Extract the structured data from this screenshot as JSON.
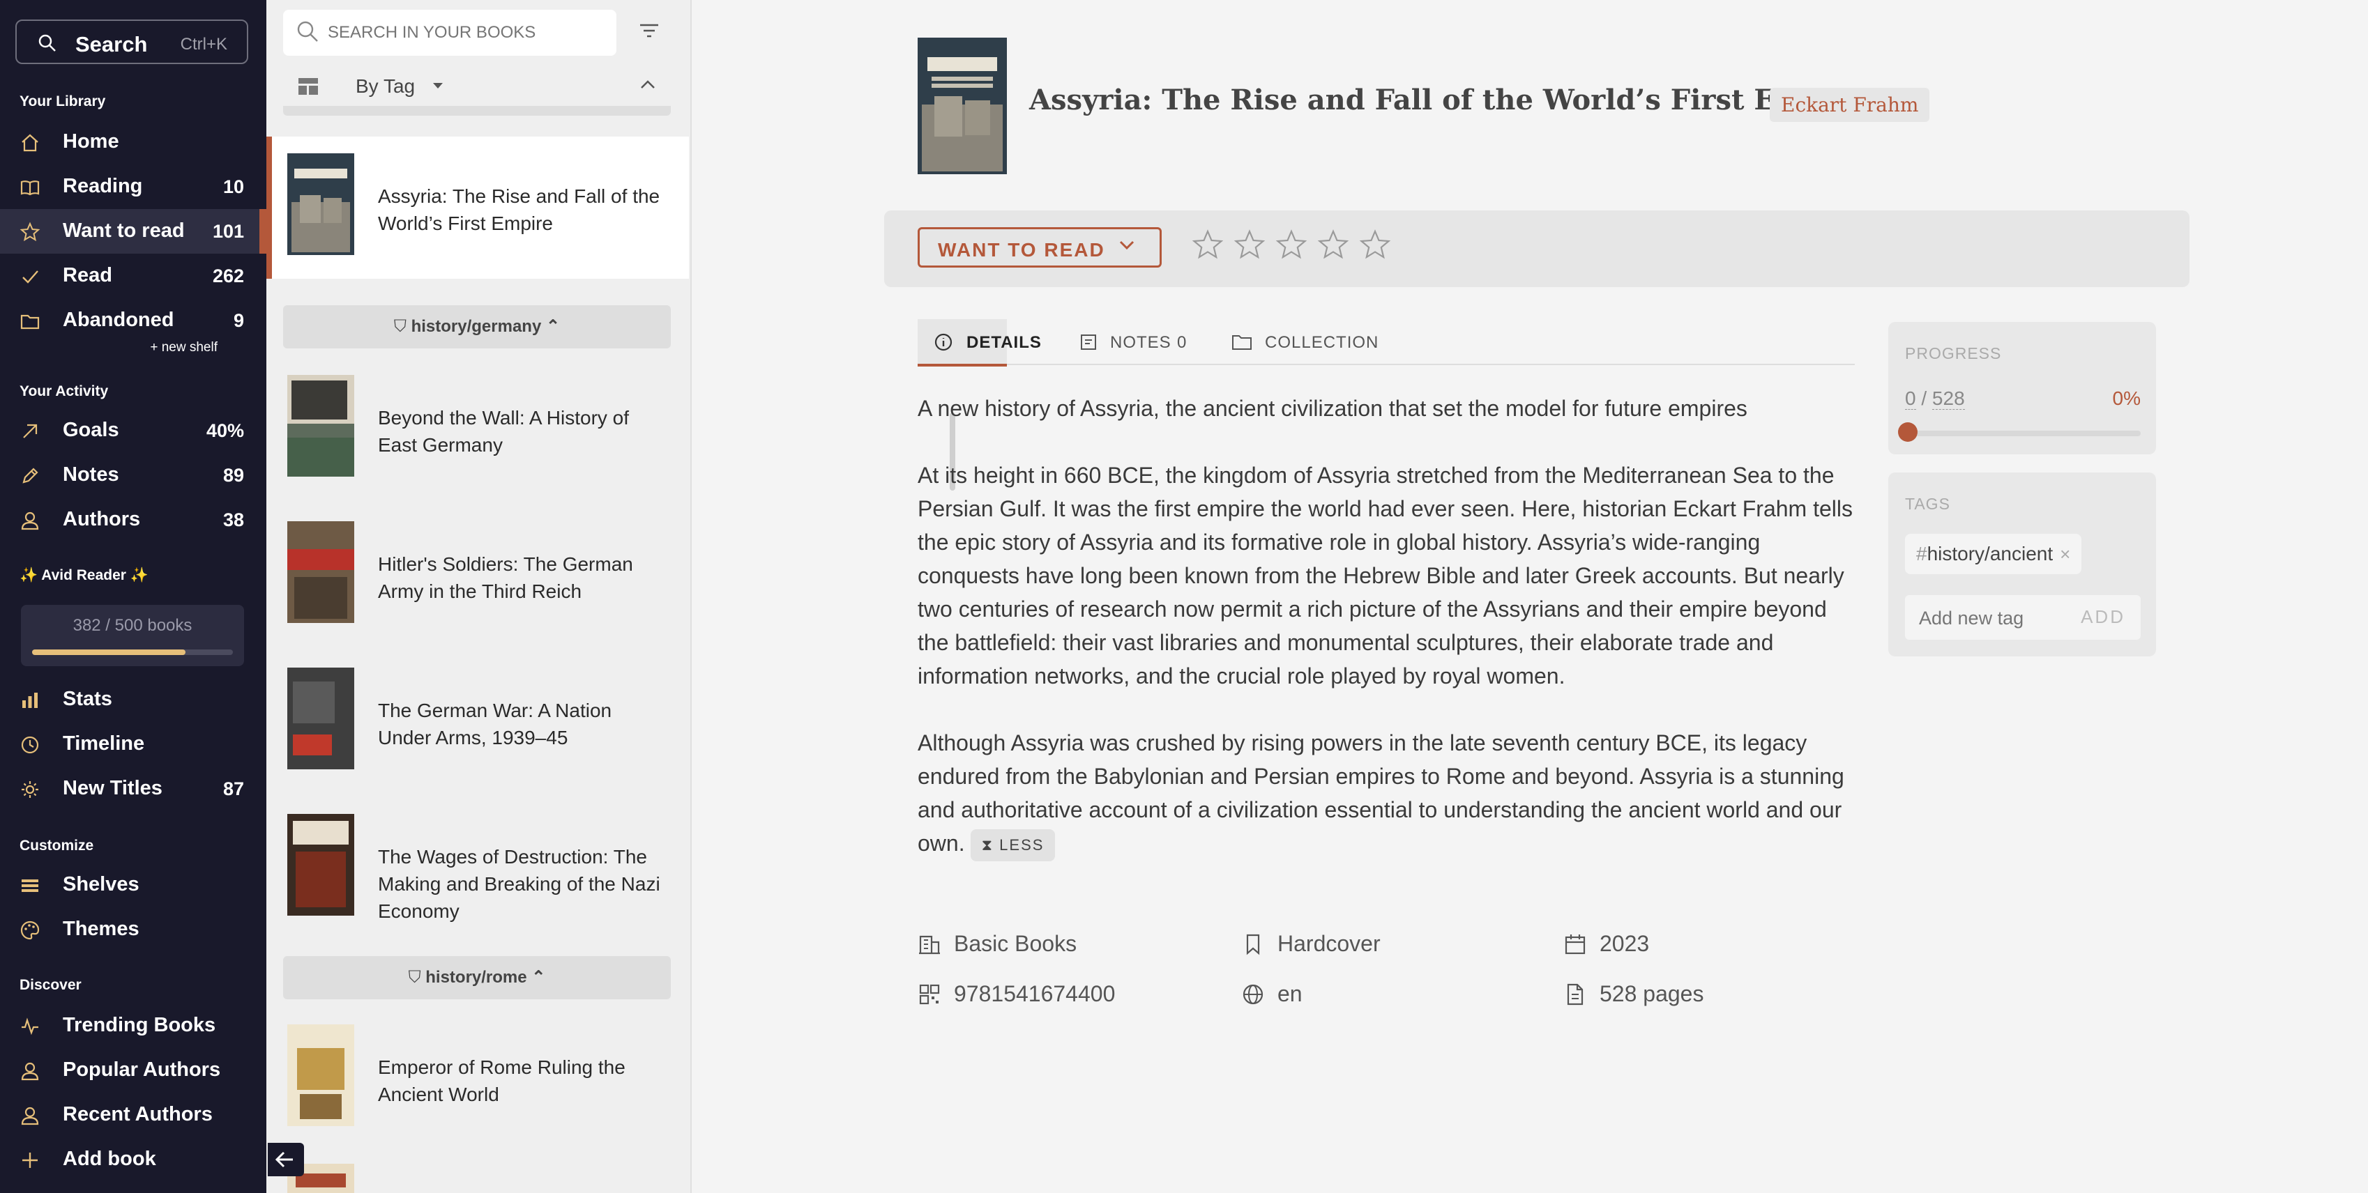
{
  "nav": {
    "search": {
      "label": "Search",
      "shortcut": "Ctrl+K"
    },
    "library_title": "Your Library",
    "library": [
      {
        "label": "Home",
        "count": ""
      },
      {
        "label": "Reading",
        "count": "10"
      },
      {
        "label": "Want to read",
        "count": "101"
      },
      {
        "label": "Read",
        "count": "262"
      },
      {
        "label": "Abandoned",
        "count": "9"
      }
    ],
    "new_shelf": "+ new shelf",
    "activity_title": "Your Activity",
    "activity": [
      {
        "label": "Goals",
        "count": "40%"
      },
      {
        "label": "Notes",
        "count": "89"
      },
      {
        "label": "Authors",
        "count": "38"
      }
    ],
    "avid_title": "✨ Avid Reader ✨",
    "goal": {
      "text": "382 / 500 books",
      "progress": 0.764
    },
    "more": [
      {
        "label": "Stats",
        "count": ""
      },
      {
        "label": "Timeline",
        "count": ""
      },
      {
        "label": "New Titles",
        "count": "87"
      }
    ],
    "customize_title": "Customize",
    "customize": [
      {
        "label": "Shelves"
      },
      {
        "label": "Themes"
      }
    ],
    "discover_title": "Discover",
    "discover": [
      {
        "label": "Trending Books"
      },
      {
        "label": "Popular Authors"
      },
      {
        "label": "Recent Authors"
      },
      {
        "label": "Add book"
      }
    ]
  },
  "list": {
    "search_placeholder": "SEARCH IN YOUR BOOKS",
    "group_by": "By Tag",
    "books": [
      {
        "title": "Assyria: The Rise and Fall of the World’s First Empire"
      },
      {
        "title": "Beyond the Wall: A History of East Germany"
      },
      {
        "title": "Hitler's Soldiers: The German Army in the Third Reich"
      },
      {
        "title": "The German War: A Nation Under Arms, 1939–45"
      },
      {
        "title": "The Wages of Destruction: The Making and Breaking of the Nazi Economy"
      },
      {
        "title": "Emperor of Rome Ruling the Ancient World"
      }
    ],
    "groups": [
      "history/germany",
      "history/rome"
    ]
  },
  "detail": {
    "title": "Assyria: The Rise and Fall of the World’s First Empire",
    "author": "Eckart Frahm",
    "status": "WANT TO READ",
    "tabs": {
      "details": "DETAILS",
      "notes": "NOTES",
      "notes_count": "0",
      "collection": "COLLECTION"
    },
    "description": [
      "A new history of Assyria, the ancient civilization that set the model for future empires",
      "At its height in 660 BCE, the kingdom of Assyria stretched from the Mediterranean Sea to the Persian Gulf. It was the first empire the world had ever seen. Here, historian Eckart Frahm tells the epic story of Assyria and its formative role in global history. Assyria’s wide-ranging conquests have long been known from the Hebrew Bible and later Greek accounts. But nearly two centuries of research now permit a rich picture of the Assyrians and their empire beyond the battlefield: their vast libraries and monumental sculptures, their elaborate trade and information networks, and the crucial role played by royal women.",
      "Although Assyria was crushed by rising powers in the late seventh century BCE, its legacy endured from the Babylonian and Persian empires to Rome and beyond. Assyria is a stunning and authoritative account of a civilization essential to understanding the ancient world and our own."
    ],
    "less": "LESS",
    "publisher": "Basic Books",
    "format": "Hardcover",
    "year": "2023",
    "isbn": "9781541674400",
    "language": "en",
    "pages": "528 pages"
  },
  "progress": {
    "label": "PROGRESS",
    "current": "0",
    "total": "528",
    "percent": "0%",
    "value": 0
  },
  "tags": {
    "label": "TAGS",
    "items": [
      "history/ancient"
    ],
    "placeholder": "Add new tag",
    "add": "ADD"
  },
  "colors": {
    "nav_bg": "#19192b",
    "accent": "#b4583a",
    "page_bg": "#f4f4f4"
  }
}
